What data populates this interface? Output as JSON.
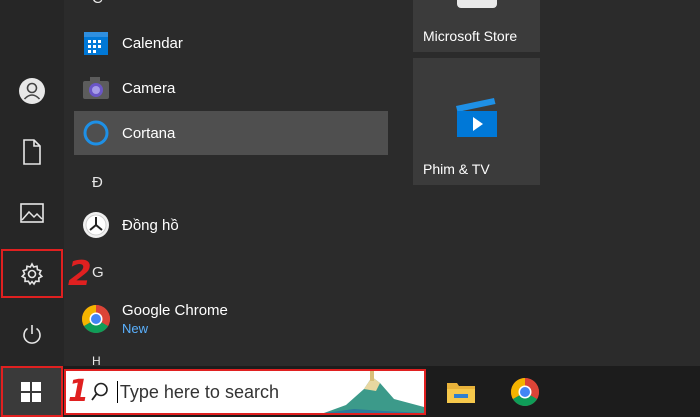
{
  "left_rail": {
    "items": [
      {
        "icon": "user-avatar-icon"
      },
      {
        "icon": "document-icon"
      },
      {
        "icon": "pictures-icon"
      },
      {
        "icon": "gear-icon"
      },
      {
        "icon": "power-icon"
      }
    ]
  },
  "app_list": {
    "letters": [
      "C",
      "Đ",
      "G",
      "H"
    ],
    "apps": [
      {
        "name": "Calendar",
        "icon": "calendar-icon"
      },
      {
        "name": "Camera",
        "icon": "camera-icon"
      },
      {
        "name": "Cortana",
        "icon": "cortana-icon"
      },
      {
        "name": "Đồng hồ",
        "icon": "clock-icon"
      },
      {
        "name": "Google Chrome",
        "icon": "chrome-icon",
        "badge": "New"
      }
    ]
  },
  "tiles": {
    "store_label": "Microsoft Store",
    "movies_label": "Phim & TV"
  },
  "taskbar": {
    "search_placeholder": "Type here to search",
    "pinned": [
      {
        "icon": "file-explorer-icon"
      },
      {
        "icon": "chrome-icon"
      }
    ]
  },
  "annotations": {
    "step1": "1",
    "step2": "2"
  },
  "colors": {
    "accent_blue": "#0078d7",
    "highlight_red": "#e02020",
    "new_badge": "#5ab1ff"
  }
}
